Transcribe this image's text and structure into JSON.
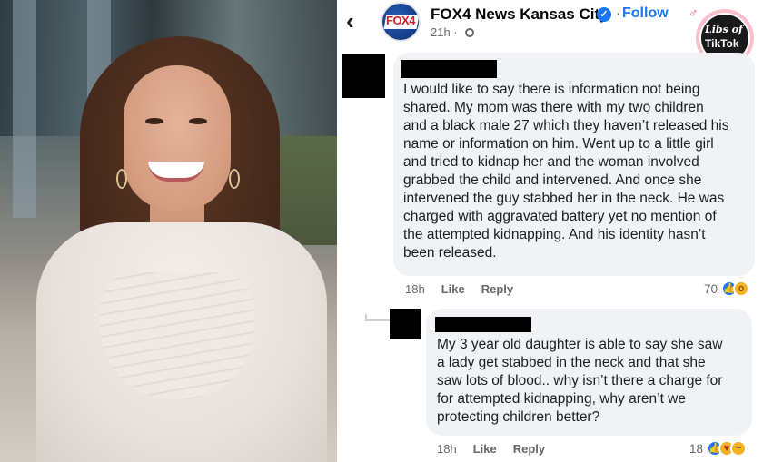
{
  "header": {
    "back_icon": "‹",
    "page_name": "FOX4 News Kansas City",
    "page_logo_text": "FOX4",
    "separator": "·",
    "follow_label": "Follow",
    "time": "21h ·"
  },
  "watermark": {
    "line1": "Libs of",
    "line2": "TikTok",
    "accent": "#e0466f"
  },
  "comments": [
    {
      "text": "I would like to say there is information not being\nshared. My mom was there with my two children\nand a black male 27 which they haven’t released his\nname or information on him. Went up to a little girl\nand tried to kidnap her and the woman involved\ngrabbed the child and intervened. And once she\nintervened the guy stabbed her in the neck. He was\ncharged with aggravated battery yet no mention of\nthe attempted kidnapping. And his identity hasn’t\nbeen released.",
      "time": "18h",
      "like_label": "Like",
      "reply_label": "Reply",
      "reaction_count": "70",
      "reactions": [
        "like-icon",
        "wow-icon"
      ]
    },
    {
      "text": "My 3 year old daughter is able to say she saw\na lady get stabbed in the neck and that she\nsaw lots of blood.. why isn’t there a charge for\nfor attempted kidnapping, why aren’t we\nprotecting children better?",
      "time": "18h",
      "like_label": "Like",
      "reply_label": "Reply",
      "reaction_count": "18",
      "reactions": [
        "like-icon",
        "care-icon",
        "sad-icon"
      ]
    }
  ],
  "colors": {
    "brand_blue": "#1877f2",
    "bubble_bg": "#f0f2f5",
    "meta_gray": "#65676b"
  }
}
